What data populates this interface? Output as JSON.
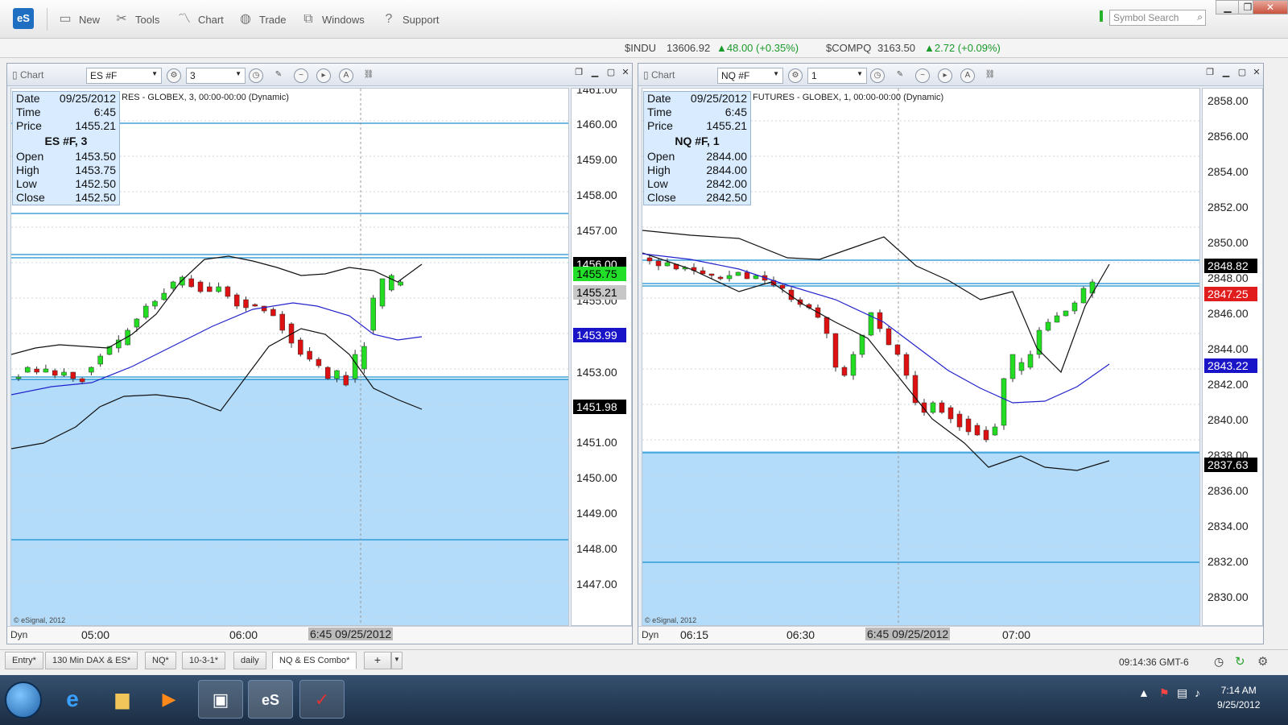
{
  "app": {
    "logo": "eS",
    "toolbar": {
      "new": "New",
      "tools": "Tools",
      "chart": "Chart",
      "trade": "Trade",
      "windows": "Windows",
      "support": "Support"
    },
    "symbol_search_placeholder": "Symbol Search"
  },
  "ticker": {
    "indu_symbol": "$INDU",
    "indu_last": "13606.92",
    "indu_change": "▲48.00 (+0.35%)",
    "compq_symbol": "$COMPQ",
    "compq_last": "3163.50",
    "compq_change": "▲2.72 (+0.09%)"
  },
  "chart_left": {
    "window_title": "Chart",
    "symbol": "ES #F",
    "interval": "3",
    "header_text": "RES - GLOBEX, 3, 00:00-00:00 (Dynamic)",
    "data_window": {
      "date_label": "Date",
      "date": "09/25/2012",
      "time_label": "Time",
      "time": "6:45",
      "price_label": "Price",
      "price": "1455.21",
      "heading": "ES #F, 3",
      "open_label": "Open",
      "open": "1453.50",
      "high_label": "High",
      "high": "1453.75",
      "low_label": "Low",
      "low": "1452.50",
      "close_label": "Close",
      "close": "1452.50"
    },
    "copyright": "© eSignal, 2012",
    "dyn": "Dyn",
    "time_labels": [
      "05:00",
      "06:00"
    ],
    "cursor_label": "6:45 09/25/2012",
    "axis_labels": [
      "1461.00",
      "1460.00",
      "1459.00",
      "1458.00",
      "1457.00",
      "1455.00",
      "1453.00",
      "1451.00",
      "1450.00",
      "1449.00",
      "1448.00",
      "1447.00"
    ],
    "price_tags": {
      "upper_band": "1456.00",
      "last": "1455.75",
      "cursor": "1455.21",
      "ma": "1453.99",
      "lower_band": "1451.98"
    }
  },
  "chart_right": {
    "window_title": "Chart",
    "symbol": "NQ #F",
    "interval": "1",
    "header_text": "FUTURES - GLOBEX, 1, 00:00-00:00 (Dynamic)",
    "data_window": {
      "date_label": "Date",
      "date": "09/25/2012",
      "time_label": "Time",
      "time": "6:45",
      "price_label": "Price",
      "price": "1455.21",
      "heading": "NQ #F, 1",
      "open_label": "Open",
      "open": "2844.00",
      "high_label": "High",
      "high": "2844.00",
      "low_label": "Low",
      "low": "2842.00",
      "close_label": "Close",
      "close": "2842.50"
    },
    "copyright": "© eSignal, 2012",
    "dyn": "Dyn",
    "time_labels": [
      "06:15",
      "06:30",
      "07:00"
    ],
    "cursor_label": "6:45 09/25/2012",
    "axis_labels": [
      "2858.00",
      "2856.00",
      "2854.00",
      "2852.00",
      "2850.00",
      "2848.00",
      "2846.00",
      "2844.00",
      "2842.00",
      "2840.00",
      "2838.00",
      "2836.00",
      "2834.00",
      "2832.00",
      "2830.00"
    ],
    "price_tags": {
      "upper_band": "2848.82",
      "last": "2847.25",
      "ma": "2843.22",
      "lower_band": "2837.63"
    }
  },
  "tabs": [
    "Entry*",
    "130 Min DAX & ES*",
    "NQ*",
    "10-3-1*",
    "daily",
    "NQ & ES Combo*"
  ],
  "active_tab": "NQ & ES Combo*",
  "status_clock": "09:14:36 GMT-6",
  "taskbar": {
    "time": "7:14 AM",
    "date": "9/25/2012"
  },
  "colors": {
    "bull": "#22dd22",
    "bear": "#dd1111",
    "ma_line": "#2222cc",
    "band_line": "#111111",
    "shade": "#b3dcfa",
    "hline": "#1a8fd0"
  }
}
